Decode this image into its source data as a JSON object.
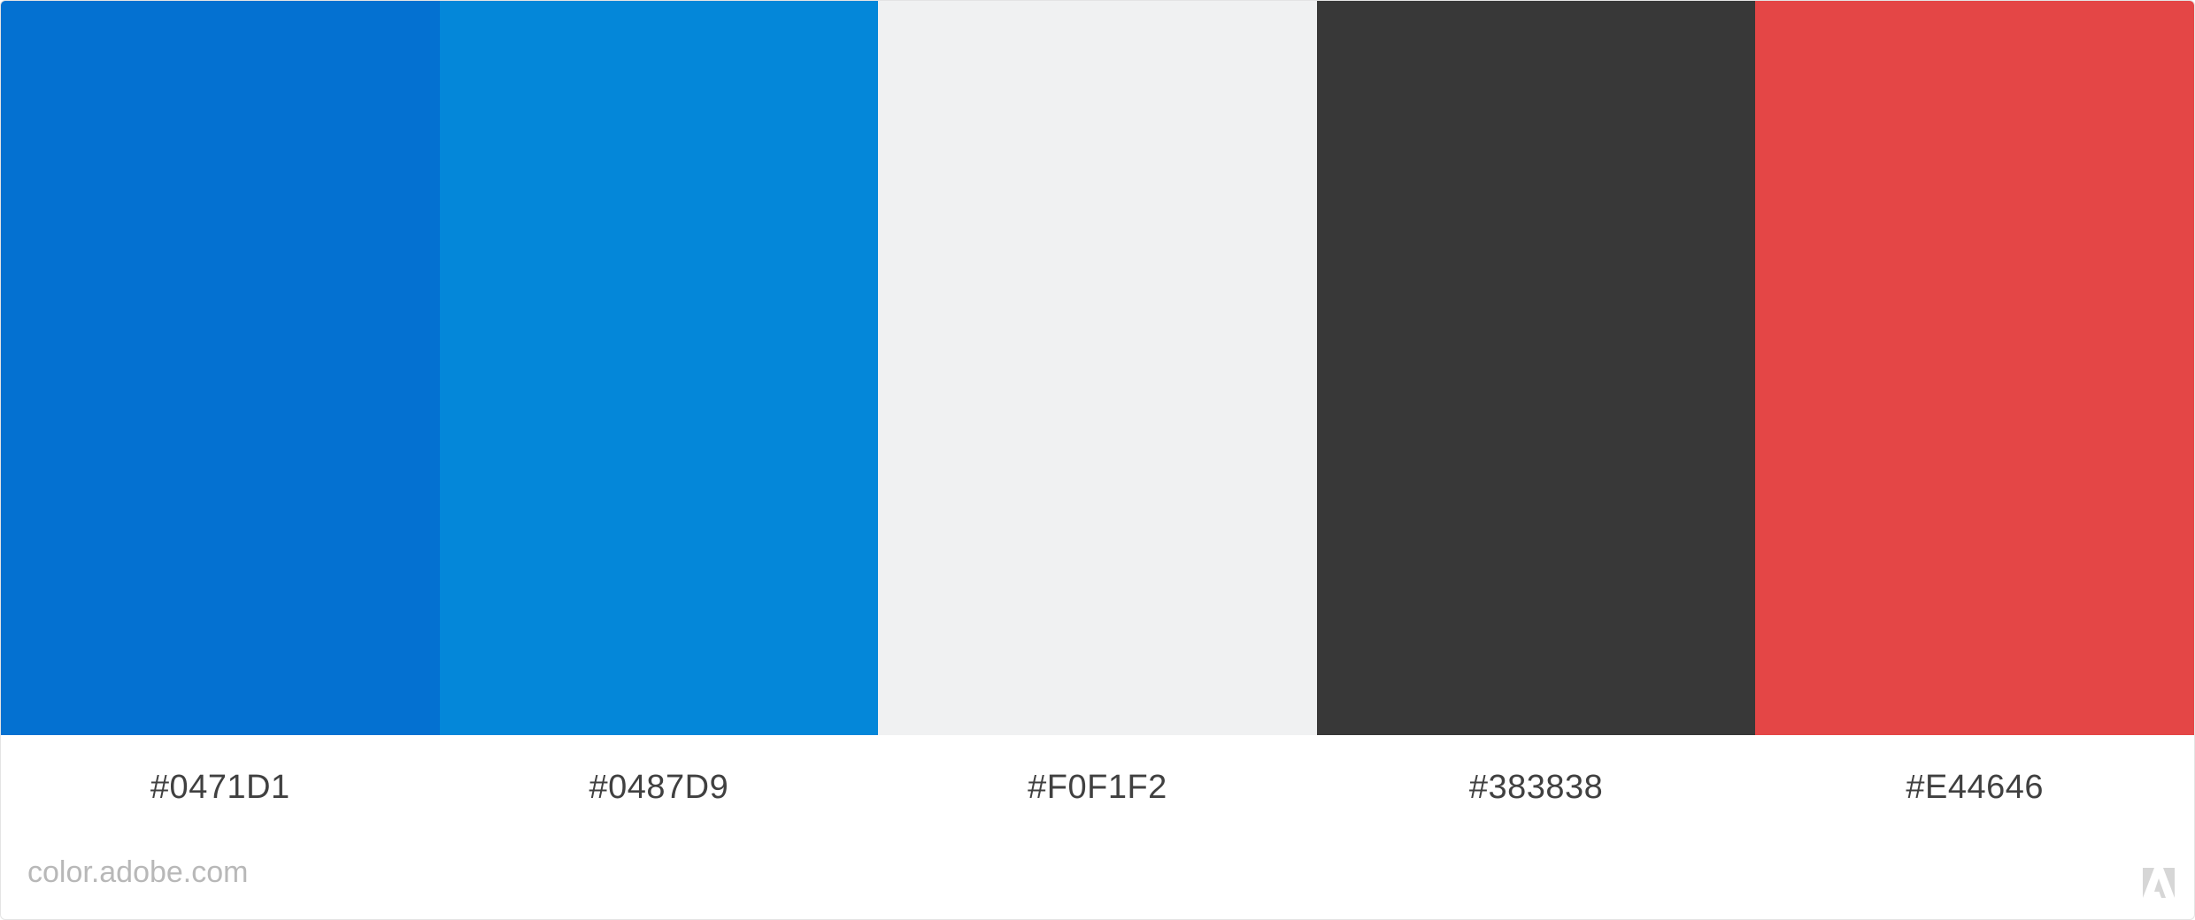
{
  "palette": {
    "swatches": [
      {
        "color": "#0471D1",
        "label": "#0471D1"
      },
      {
        "color": "#0487D9",
        "label": "#0487D9"
      },
      {
        "color": "#F0F1F2",
        "label": "#F0F1F2"
      },
      {
        "color": "#383838",
        "label": "#383838"
      },
      {
        "color": "#E44646",
        "label": "#E44646"
      }
    ]
  },
  "footer": {
    "site_text": "color.adobe.com",
    "logo_icon": "adobe-logo-icon"
  }
}
